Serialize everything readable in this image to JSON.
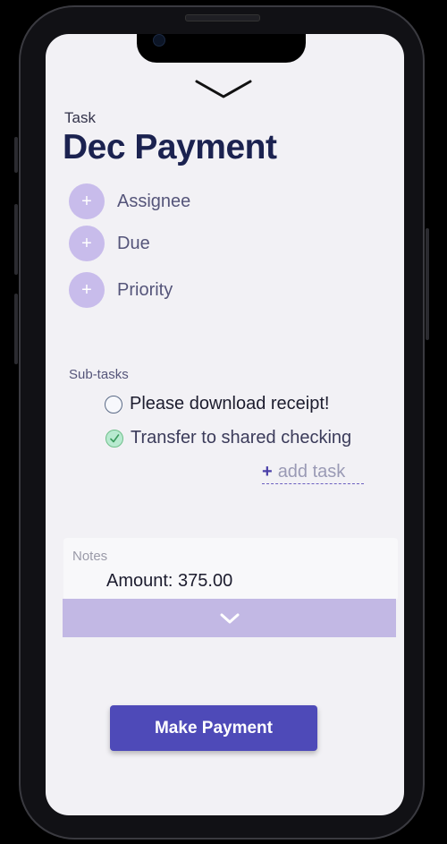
{
  "task": {
    "label": "Task",
    "title": "Dec Payment"
  },
  "fields": [
    {
      "icon": "plus",
      "label": "Assignee"
    },
    {
      "icon": "plus",
      "label": "Due"
    },
    {
      "icon": "plus",
      "label": "Priority"
    }
  ],
  "subtasks": {
    "label": "Sub-tasks",
    "items": [
      {
        "text": "Please download receipt!",
        "done": false
      },
      {
        "text": "Transfer to shared checking",
        "done": true
      }
    ],
    "add_label": "add task",
    "add_icon": "+"
  },
  "notes": {
    "label": "Notes",
    "body": "Amount: 375.00"
  },
  "actions": {
    "primary_label": "Make Payment"
  },
  "colors": {
    "accent": "#4e4ab8",
    "title": "#1b2250",
    "chip": "#c8bceb",
    "expand_bar": "#c2b8e4",
    "check_done": "#b8ead0"
  },
  "icons": {
    "collapse": "chevron-down-icon",
    "expand": "chevron-down-icon",
    "field_add": "plus-icon",
    "subtask_done": "checkmark-icon"
  }
}
